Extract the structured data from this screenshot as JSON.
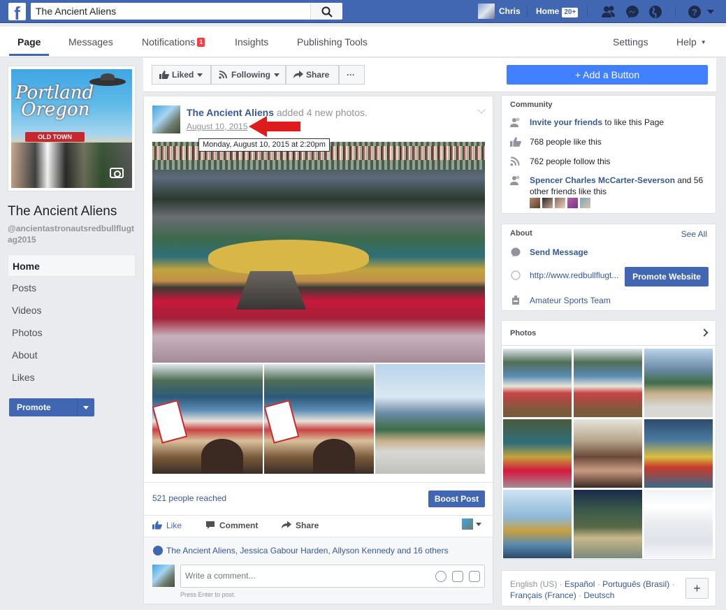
{
  "topbar": {
    "search_value": "The Ancient Aliens",
    "user_name": "Chris",
    "home_label": "Home",
    "home_badge": "20+"
  },
  "subnav": {
    "tabs": [
      {
        "label": "Page"
      },
      {
        "label": "Messages"
      },
      {
        "label": "Notifications"
      },
      {
        "label": "Insights"
      },
      {
        "label": "Publishing Tools"
      }
    ],
    "notif_badge": "1",
    "settings": "Settings",
    "help": "Help"
  },
  "left": {
    "page_name": "The Ancient Aliens",
    "handle": "@ancientastronautsredbullflugtag2015",
    "nav": [
      "Home",
      "Posts",
      "Videos",
      "Photos",
      "About",
      "Likes"
    ],
    "promote": "Promote"
  },
  "actionbar": {
    "liked": "Liked",
    "following": "Following",
    "share": "Share",
    "more": "···",
    "add_button": "+ Add a Button"
  },
  "post": {
    "author": "The Ancient Aliens",
    "action": " added 4 new photos.",
    "date": "August 10, 2015",
    "tooltip": "Monday, August 10, 2015 at 2:20pm",
    "reach": "521 people reached",
    "boost": "Boost Post",
    "like": "Like",
    "comment": "Comment",
    "share": "Share",
    "likes_text": "The Ancient Aliens, Jessica Gabour Harden, Allyson Kennedy and 16 others",
    "comment_placeholder": "Write a comment...",
    "comment_hint": "Press Enter to post."
  },
  "community": {
    "title": "Community",
    "invite_link": "Invite your friends",
    "invite_rest": " to like this Page",
    "likes": "768 people like this",
    "follows": "762 people follow this",
    "friend_name": "Spencer Charles McCarter-Severson",
    "friend_rest": " and 56",
    "friend_rest2": "other friends like this"
  },
  "about": {
    "title": "About",
    "see_all": "See All",
    "send_message": "Send Message",
    "website": "http://www.redbullflugt...",
    "promote_website": "Promote Website",
    "category": "Amateur Sports Team"
  },
  "photos": {
    "title": "Photos"
  },
  "languages": {
    "current": "English (US)",
    "sep": " · ",
    "l1": "Español",
    "l2": "Português (Brasil)",
    "l3": "Français (France)",
    "l4": "Deutsch",
    "add": "+"
  },
  "colors": {
    "brand": "#4267b2",
    "add_button": "#4080ff",
    "notif": "#fa3e3e"
  }
}
